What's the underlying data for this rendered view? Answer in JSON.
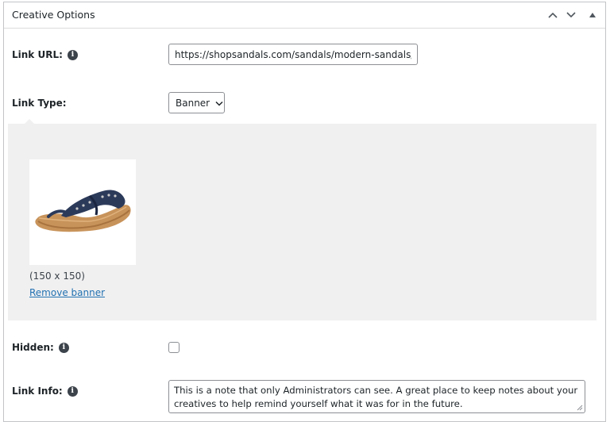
{
  "panel": {
    "title": "Creative Options",
    "controls": {
      "move_up_icon": "chevron-up-icon",
      "move_down_icon": "chevron-down-icon",
      "toggle_icon": "triangle-up-icon"
    }
  },
  "fields": {
    "link_url": {
      "label": "Link URL:",
      "value": "https://shopsandals.com/sandals/modern-sandals/"
    },
    "link_type": {
      "label": "Link Type:",
      "selected": "Banner"
    },
    "banner": {
      "image_alt": "Navy blue toe-post sandal",
      "dimensions": "(150 x 150)",
      "remove_label": "Remove banner"
    },
    "hidden": {
      "label": "Hidden:",
      "checked": false
    },
    "link_info": {
      "label": "Link Info:",
      "value": "This is a note that only Administrators can see. A great place to keep notes about your creatives to help remind yourself what it was for in the future."
    }
  },
  "colors": {
    "link": "#2271b1",
    "banner_bg": "#f0f0f1",
    "border": "#8c8f94"
  }
}
